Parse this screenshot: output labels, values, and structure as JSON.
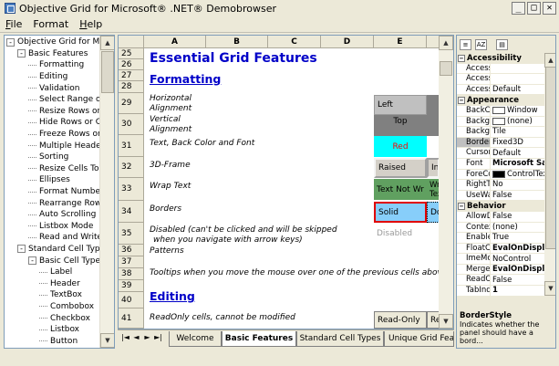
{
  "window": {
    "title": "Objective Grid for Microsoft® .NET® Demobrowser",
    "buttons": {
      "minimize": "_",
      "maximize": "□",
      "close": "✕"
    }
  },
  "menu": [
    {
      "label": "File",
      "u": "F",
      "rest": "ile"
    },
    {
      "label": "Format",
      "u": "",
      "rest": "Format"
    },
    {
      "label": "Help",
      "u": "H",
      "rest": "elp"
    }
  ],
  "tree": {
    "items": [
      {
        "label": "Objective Grid for Microsoft",
        "level": 0,
        "expander": "-"
      },
      {
        "label": "Basic Features",
        "level": 1,
        "expander": "-"
      },
      {
        "label": "Formatting",
        "level": 2
      },
      {
        "label": "Editing",
        "level": 2
      },
      {
        "label": "Validation",
        "level": 2
      },
      {
        "label": "Select Range of Cells",
        "level": 2
      },
      {
        "label": "Resize Rows or Columns",
        "level": 2
      },
      {
        "label": "Hide Rows or Columns",
        "level": 2
      },
      {
        "label": "Freeze Rows or Columns",
        "level": 2
      },
      {
        "label": "Multiple Header Rows",
        "level": 2
      },
      {
        "label": "Sorting",
        "level": 2
      },
      {
        "label": "Resize Cells To Fit",
        "level": 2
      },
      {
        "label": "Ellipses",
        "level": 2
      },
      {
        "label": "Format Numbers",
        "level": 2
      },
      {
        "label": "Rearrange Rows",
        "level": 2
      },
      {
        "label": "Auto Scrolling",
        "level": 2
      },
      {
        "label": "Listbox Mode",
        "level": 2
      },
      {
        "label": "Read and Write Tab",
        "level": 2
      },
      {
        "label": "Standard Cell Types",
        "level": 1,
        "expander": "-"
      },
      {
        "label": "Basic Cell Types",
        "level": 2,
        "expander": "-"
      },
      {
        "label": "Label",
        "level": 3
      },
      {
        "label": "Header",
        "level": 3
      },
      {
        "label": "TextBox",
        "level": 3
      },
      {
        "label": "Combobox",
        "level": 3
      },
      {
        "label": "Checkbox",
        "level": 3
      },
      {
        "label": "Listbox",
        "level": 3
      },
      {
        "label": "Button",
        "level": 3
      }
    ]
  },
  "grid": {
    "columns": [
      "A",
      "B",
      "C",
      "D",
      "E"
    ],
    "rows": [
      {
        "num": "25"
      },
      {
        "num": "26"
      },
      {
        "num": "27"
      },
      {
        "num": "28"
      },
      {
        "num": "29"
      },
      {
        "num": "30"
      },
      {
        "num": "31"
      },
      {
        "num": "32"
      },
      {
        "num": "33"
      },
      {
        "num": "34"
      },
      {
        "num": "35"
      },
      {
        "num": "36"
      },
      {
        "num": "37"
      },
      {
        "num": "38"
      },
      {
        "num": "39"
      },
      {
        "num": "40"
      },
      {
        "num": "41"
      }
    ],
    "title": "Essential Grid Features",
    "section_formatting": "Formatting",
    "section_editing": "Editing",
    "descriptions": {
      "r29a": "Horizontal",
      "r29b": "Alignment",
      "r30a": "Vertical",
      "r30b": "Alignment",
      "r31": "Text, Back Color and Font",
      "r32": "3D-Frame",
      "r33": "Wrap Text",
      "r34": "Borders",
      "r35a": "Disabled (can't be clicked and will be skipped",
      "r35b": "when you navigate with arrow keys)",
      "r36": "Patterns",
      "r38": "Tooltips when you move the mouse over one of the previous cells above.",
      "r41": "ReadOnly cells, cannot be modified"
    },
    "samples": {
      "left": "Left",
      "top": "Top",
      "red": "Red",
      "raised": "Raised",
      "inset": "Ins",
      "wrap": "Text Not Wr",
      "wrap2a": "Wra",
      "wrap2b": "Tex",
      "solid": "Solid",
      "dot": "Dot",
      "disabled": "Disabled",
      "readonly": "Read-Only",
      "readonly2": "Rea"
    }
  },
  "tabs": {
    "nav": [
      "|◄",
      "◄",
      "►",
      "►|"
    ],
    "items": [
      "Welcome",
      "Basic Features",
      "Standard Cell Types",
      "Unique Grid Features"
    ],
    "active": "Basic Features"
  },
  "properties": {
    "categories": [
      {
        "name": "Accessibility",
        "rows": [
          {
            "name": "AccessibleDescription",
            "value": ""
          },
          {
            "name": "AccessibleName",
            "value": ""
          },
          {
            "name": "AccessibleRole",
            "value": "Default"
          }
        ]
      },
      {
        "name": "Appearance",
        "rows": [
          {
            "name": "BackColor",
            "value": "Window",
            "swatch": "#ffffff"
          },
          {
            "name": "BackgroundImage",
            "value": "(none)",
            "swatch": "#ffffff"
          },
          {
            "name": "BackgroundImageLayout",
            "value": "Tile"
          },
          {
            "name": "BorderStyle",
            "value": "Fixed3D",
            "selected": true
          },
          {
            "name": "Cursor",
            "value": "Default"
          },
          {
            "name": "Font",
            "value": "Microsoft Sans",
            "bold": true,
            "toggle": "+"
          },
          {
            "name": "ForeColor",
            "value": "ControlText",
            "swatch": "#000000"
          },
          {
            "name": "RightToLeft",
            "value": "No"
          },
          {
            "name": "UseWaitCursor",
            "value": "False"
          }
        ]
      },
      {
        "name": "Behavior",
        "rows": [
          {
            "name": "AllowDrop",
            "value": "False"
          },
          {
            "name": "ContextMenuStrip",
            "value": "(none)"
          },
          {
            "name": "Enabled",
            "value": "True"
          },
          {
            "name": "FloatCellsMode",
            "value": "EvalOnDisplay",
            "bold": true
          },
          {
            "name": "ImeMode",
            "value": "NoControl"
          },
          {
            "name": "MergeCellsMode",
            "value": "EvalOnDisplay",
            "bold": true
          },
          {
            "name": "ReadOnly",
            "value": "False"
          },
          {
            "name": "TabIndex",
            "value": "1",
            "bold": true
          }
        ]
      }
    ],
    "description_title": "BorderStyle",
    "description_text": "Indicates whether the panel should have a bord..."
  },
  "colors": {
    "heading": "#0000c8",
    "top_cell": "#808080",
    "red_cell_bg": "#00ffff",
    "red_cell_fg": "#ff0000",
    "wrap_cell": "#60a060",
    "solid_cell": "#87cefa",
    "solid_border": "#e00000"
  }
}
